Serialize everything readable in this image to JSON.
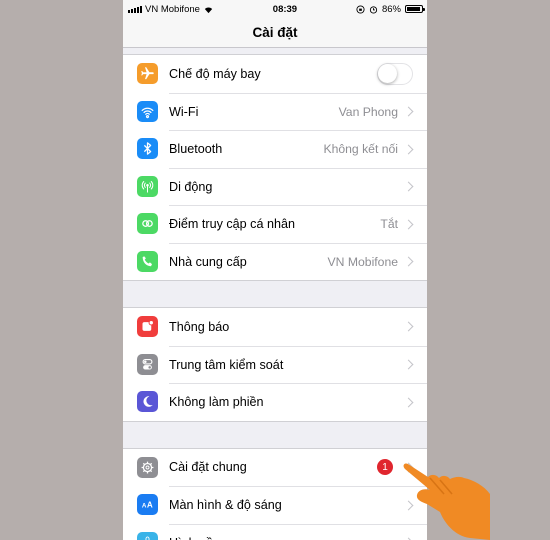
{
  "status_bar": {
    "carrier": "VN Mobifone",
    "time": "08:39",
    "battery": "86%"
  },
  "nav": {
    "title": "Cài đặt"
  },
  "groups": [
    [
      {
        "label": "Chế độ máy bay",
        "value": "",
        "control": "toggle",
        "toggle_on": false,
        "icon": "airplane-icon",
        "color": "#f59c2b"
      },
      {
        "label": "Wi-Fi",
        "value": "Van Phong",
        "icon": "wifi-icon",
        "color": "#1a8cf7"
      },
      {
        "label": "Bluetooth",
        "value": "Không kết nối",
        "icon": "bluetooth-icon",
        "color": "#1a8cf7"
      },
      {
        "label": "Di động",
        "value": "",
        "icon": "cellular-icon",
        "color": "#4cd964"
      },
      {
        "label": "Điểm truy cập cá nhân",
        "value": "Tắt",
        "icon": "hotspot-icon",
        "color": "#4cd964"
      },
      {
        "label": "Nhà cung cấp",
        "value": "VN Mobifone",
        "icon": "phone-icon",
        "color": "#4cd964"
      }
    ],
    [
      {
        "label": "Thông báo",
        "value": "",
        "icon": "notifications-icon",
        "color": "#f03d3c"
      },
      {
        "label": "Trung tâm kiểm soát",
        "value": "",
        "icon": "control-center-icon",
        "color": "#8e8e93"
      },
      {
        "label": "Không làm phiền",
        "value": "",
        "icon": "moon-icon",
        "color": "#5a56d6"
      }
    ],
    [
      {
        "label": "Cài đặt chung",
        "value": "",
        "badge": "1",
        "icon": "gear-icon",
        "color": "#8e8e93"
      },
      {
        "label": "Màn hình & độ sáng",
        "value": "",
        "icon": "display-icon",
        "color": "#1a7cf2"
      },
      {
        "label": "Hình nền",
        "value": "",
        "icon": "wallpaper-icon",
        "color": "#39b3e8"
      }
    ]
  ]
}
